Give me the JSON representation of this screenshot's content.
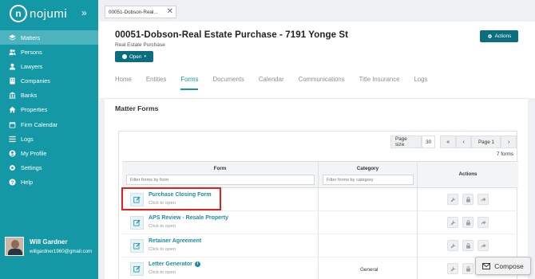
{
  "app": {
    "brand": "nojumi",
    "logo_letter": "n"
  },
  "sidebar": {
    "items": [
      {
        "label": "Matters",
        "icon": "layers-icon",
        "active": true
      },
      {
        "label": "Persons",
        "icon": "users-icon"
      },
      {
        "label": "Lawyers",
        "icon": "user-icon"
      },
      {
        "label": "Companies",
        "icon": "building-icon"
      },
      {
        "label": "Banks",
        "icon": "bank-icon"
      },
      {
        "label": "Properties",
        "icon": "home-icon"
      },
      {
        "label": "Firm Calendar",
        "icon": "calendar-icon"
      },
      {
        "label": "Logs",
        "icon": "list-icon"
      },
      {
        "label": "My Profile",
        "icon": "profile-icon"
      },
      {
        "label": "Settings",
        "icon": "gear-icon"
      },
      {
        "label": "Help",
        "icon": "help-icon"
      }
    ]
  },
  "user": {
    "name": "Will Gardner",
    "email": "willgardner1960@gmail.com"
  },
  "browser_tab": {
    "label": "00051-Dobson-Real..."
  },
  "matter": {
    "title": "00051-Dobson-Real Estate Purchase - 7191 Yonge St",
    "subtitle": "Real Estate Purchase",
    "open_label": "Open",
    "actions_label": "Actions"
  },
  "tabs": [
    "Home",
    "Entities",
    "Forms",
    "Documents",
    "Calendar",
    "Communications",
    "Title Insurance",
    "Logs"
  ],
  "active_tab": "Forms",
  "forms": {
    "title": "Matter Forms",
    "page_size_label": "Page size",
    "page_size": "30",
    "page_label": "Page 1",
    "count": "7 forms",
    "col_form": "Form",
    "col_category": "Category",
    "col_actions": "Actions",
    "filter_form_placeholder": "Filter forms by form",
    "filter_category_placeholder": "Filter forms by category",
    "rows": [
      {
        "name": "Purchase Closing Form",
        "sub": "Click to open",
        "category": "",
        "info": false
      },
      {
        "name": "APS Review - Resale Property",
        "sub": "Click to open",
        "category": "",
        "info": false
      },
      {
        "name": "Retainer Agreement",
        "sub": "Click to open",
        "category": "",
        "info": false
      },
      {
        "name": "Letter Generator",
        "sub": "Click to open",
        "category": "General",
        "info": true
      }
    ]
  },
  "compose_label": "Compose",
  "colors": {
    "sidebar": "#1498a6",
    "accent": "#0b6e80",
    "highlight": "#e0201b"
  }
}
